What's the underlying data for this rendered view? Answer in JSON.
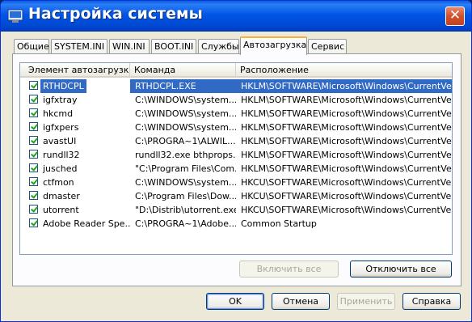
{
  "window": {
    "title": "Настройка системы"
  },
  "tabs": [
    {
      "label": "Общие"
    },
    {
      "label": "SYSTEM.INI"
    },
    {
      "label": "WIN.INI"
    },
    {
      "label": "BOOT.INI"
    },
    {
      "label": "Службы"
    },
    {
      "label": "Автозагрузка",
      "active": true
    },
    {
      "label": "Сервис"
    }
  ],
  "columns": [
    "Элемент автозагрузки",
    "Команда",
    "Расположение"
  ],
  "rows": [
    {
      "item": "RTHDCPL",
      "command": "RTHDCPL.EXE",
      "location": "HKLM\\SOFTWARE\\Microsoft\\Windows\\CurrentVer...",
      "checked": true,
      "selected": true
    },
    {
      "item": "igfxtray",
      "command": "C:\\WINDOWS\\system...",
      "location": "HKLM\\SOFTWARE\\Microsoft\\Windows\\CurrentVer...",
      "checked": true
    },
    {
      "item": "hkcmd",
      "command": "C:\\WINDOWS\\system...",
      "location": "HKLM\\SOFTWARE\\Microsoft\\Windows\\CurrentVer...",
      "checked": true
    },
    {
      "item": "igfxpers",
      "command": "C:\\WINDOWS\\system...",
      "location": "HKLM\\SOFTWARE\\Microsoft\\Windows\\CurrentVer...",
      "checked": true
    },
    {
      "item": "avastUI",
      "command": "C:\\PROGRA~1\\ALWIL...",
      "location": "HKLM\\SOFTWARE\\Microsoft\\Windows\\CurrentVer...",
      "checked": true
    },
    {
      "item": "rundll32",
      "command": "rundll32.exe bthprops...",
      "location": "HKLM\\SOFTWARE\\Microsoft\\Windows\\CurrentVer...",
      "checked": true
    },
    {
      "item": "jusched",
      "command": "\"C:\\Program Files\\Com...",
      "location": "HKLM\\SOFTWARE\\Microsoft\\Windows\\CurrentVer...",
      "checked": true
    },
    {
      "item": "ctfmon",
      "command": "C:\\WINDOWS\\system...",
      "location": "HKCU\\SOFTWARE\\Microsoft\\Windows\\CurrentVer...",
      "checked": true
    },
    {
      "item": "dmaster",
      "command": "C:\\Program Files\\Dow...",
      "location": "HKCU\\SOFTWARE\\Microsoft\\Windows\\CurrentVer...",
      "checked": true
    },
    {
      "item": "utorrent",
      "command": "\"D:\\Distrib\\utorrent.exe\"",
      "location": "HKCU\\SOFTWARE\\Microsoft\\Windows\\CurrentVer...",
      "checked": true
    },
    {
      "item": "Adobe Reader Spe...",
      "command": "C:\\PROGRA~1\\Adobe...",
      "location": "Common Startup",
      "checked": true
    }
  ],
  "panel_buttons": {
    "enable_all": "Включить все",
    "disable_all": "Отключить все"
  },
  "dialog_buttons": {
    "ok": "OK",
    "cancel": "Отмена",
    "apply": "Применить",
    "help": "Справка"
  },
  "colors": {
    "titlebar": "#0055e5",
    "selection": "#316ac5",
    "face": "#ece9d8",
    "close": "#d0502a"
  },
  "icons": {
    "title_icon": "msconfig-icon",
    "close": "close-icon",
    "check": "checkmark-icon"
  }
}
